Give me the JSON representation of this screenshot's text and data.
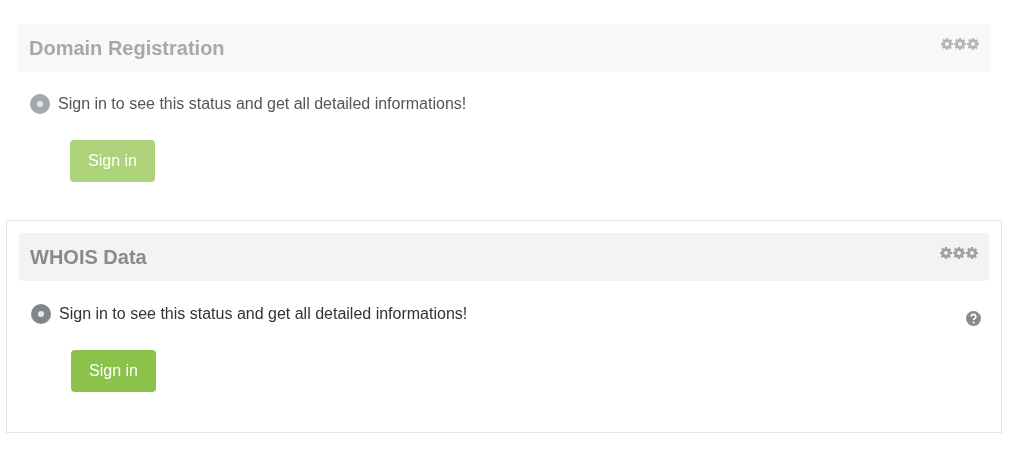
{
  "panels": [
    {
      "title": "Domain Registration",
      "dimmed": true,
      "help": false,
      "message": "Sign in to see this status and get all detailed informations!",
      "button": "Sign in"
    },
    {
      "title": "WHOIS Data",
      "dimmed": false,
      "help": true,
      "message": "Sign in to see this status and get all detailed informations!",
      "button": "Sign in"
    }
  ]
}
